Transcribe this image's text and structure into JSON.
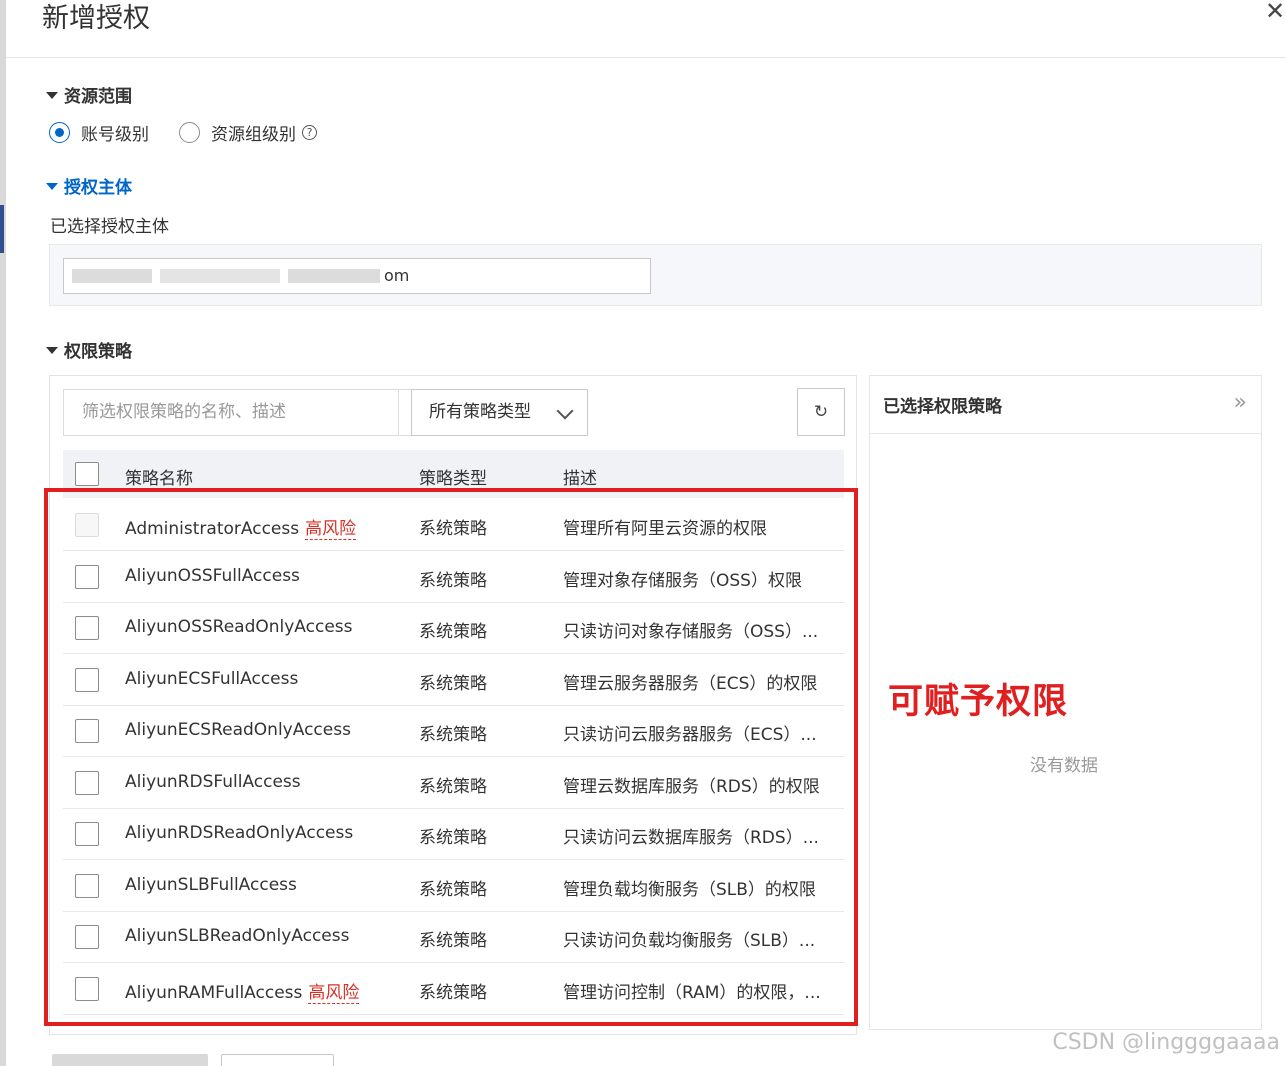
{
  "dialog": {
    "title": "新增授权"
  },
  "resource_scope": {
    "heading": "资源范围",
    "options": [
      {
        "label": "账号级别",
        "checked": true
      },
      {
        "label": "资源组级别",
        "checked": false
      }
    ]
  },
  "principal": {
    "heading": "授权主体",
    "selected_label": "已选择授权主体",
    "value_visible": "om"
  },
  "policies": {
    "heading": "权限策略",
    "search_placeholder": "筛选权限策略的名称、描述",
    "type_filter": "所有策略类型",
    "columns": [
      "策略名称",
      "策略类型",
      "描述"
    ],
    "high_risk_label": "高风险",
    "rows": [
      {
        "name": "AdministratorAccess",
        "high_risk": true,
        "type": "系统策略",
        "desc": "管理所有阿里云资源的权限",
        "disabled": true
      },
      {
        "name": "AliyunOSSFullAccess",
        "high_risk": false,
        "type": "系统策略",
        "desc": "管理对象存储服务（OSS）权限",
        "disabled": false
      },
      {
        "name": "AliyunOSSReadOnlyAccess",
        "high_risk": false,
        "type": "系统策略",
        "desc": "只读访问对象存储服务（OSS）...",
        "disabled": false
      },
      {
        "name": "AliyunECSFullAccess",
        "high_risk": false,
        "type": "系统策略",
        "desc": "管理云服务器服务（ECS）的权限",
        "disabled": false
      },
      {
        "name": "AliyunECSReadOnlyAccess",
        "high_risk": false,
        "type": "系统策略",
        "desc": "只读访问云服务器服务（ECS）...",
        "disabled": false
      },
      {
        "name": "AliyunRDSFullAccess",
        "high_risk": false,
        "type": "系统策略",
        "desc": "管理云数据库服务（RDS）的权限",
        "disabled": false
      },
      {
        "name": "AliyunRDSReadOnlyAccess",
        "high_risk": false,
        "type": "系统策略",
        "desc": "只读访问云数据库服务（RDS）...",
        "disabled": false
      },
      {
        "name": "AliyunSLBFullAccess",
        "high_risk": false,
        "type": "系统策略",
        "desc": "管理负载均衡服务（SLB）的权限",
        "disabled": false
      },
      {
        "name": "AliyunSLBReadOnlyAccess",
        "high_risk": false,
        "type": "系统策略",
        "desc": "只读访问负载均衡服务（SLB）...",
        "disabled": false
      },
      {
        "name": "AliyunRAMFullAccess",
        "high_risk": true,
        "type": "系统策略",
        "desc": "管理访问控制（RAM）的权限，...",
        "disabled": false
      }
    ]
  },
  "selected_panel": {
    "title": "已选择权限策略",
    "empty_text": "没有数据"
  },
  "annotation": "可赋予权限",
  "watermark": "CSDN @linggggaaaa",
  "colors": {
    "accent": "#0064c8",
    "risk": "#d93026",
    "annotation": "#e02020"
  }
}
